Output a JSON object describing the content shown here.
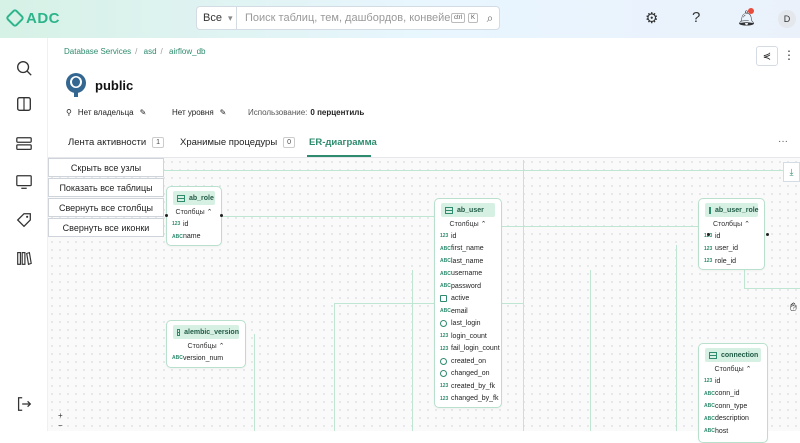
{
  "header": {
    "logo_text": "ADC",
    "search": {
      "scope": "Все",
      "placeholder": "Поиск таблиц, тем, дашбордов, конвейеров, м...",
      "shortcut_ctrl": "ctrl",
      "shortcut_key": "K"
    },
    "user_initial": "D"
  },
  "breadcrumb": [
    "Database Services",
    "asd",
    "airflow_db"
  ],
  "page": {
    "title": "public",
    "owner": "Нет владельца",
    "tier": "Нет уровня",
    "usage_label": "Использование:",
    "usage_value": "0 перцентиль"
  },
  "tabs": [
    {
      "label": "Лента активности",
      "count": "1"
    },
    {
      "label": "Хранимые процедуры",
      "count": "0"
    },
    {
      "label": "ER-диаграмма",
      "count": ""
    }
  ],
  "controls": {
    "hide_nodes": "Скрыть все узлы",
    "show_tables": "Показать все таблицы",
    "collapse_columns": "Свернуть все столбцы",
    "collapse_icons": "Свернуть все иконки",
    "zoom_in": "+",
    "zoom_out": "−"
  },
  "columns_label": "Столбцы",
  "nodes": {
    "ab_role": {
      "name": "ab_role",
      "columns": [
        {
          "type": "123",
          "name": "id"
        },
        {
          "type": "ABC",
          "name": "name"
        }
      ]
    },
    "ab_user": {
      "name": "ab_user",
      "columns": [
        {
          "type": "123",
          "name": "id"
        },
        {
          "type": "ABC",
          "name": "first_name"
        },
        {
          "type": "ABC",
          "name": "last_name"
        },
        {
          "type": "ABC",
          "name": "username"
        },
        {
          "type": "ABC",
          "name": "password"
        },
        {
          "type": "bool",
          "name": "active"
        },
        {
          "type": "ABC",
          "name": "email"
        },
        {
          "type": "time",
          "name": "last_login"
        },
        {
          "type": "123",
          "name": "login_count"
        },
        {
          "type": "123",
          "name": "fail_login_count"
        },
        {
          "type": "time",
          "name": "created_on"
        },
        {
          "type": "time",
          "name": "changed_on"
        },
        {
          "type": "123",
          "name": "created_by_fk"
        },
        {
          "type": "123",
          "name": "changed_by_fk"
        }
      ]
    },
    "ab_user_role": {
      "name": "ab_user_role",
      "columns": [
        {
          "type": "123",
          "name": "id"
        },
        {
          "type": "123",
          "name": "user_id"
        },
        {
          "type": "123",
          "name": "role_id"
        }
      ]
    },
    "alembic_version": {
      "name": "alembic_version",
      "columns": [
        {
          "type": "ABC",
          "name": "version_num"
        }
      ]
    },
    "connection": {
      "name": "connection",
      "columns": [
        {
          "type": "123",
          "name": "id"
        },
        {
          "type": "ABC",
          "name": "conn_id"
        },
        {
          "type": "ABC",
          "name": "conn_type"
        },
        {
          "type": "ABC",
          "name": "description"
        },
        {
          "type": "ABC",
          "name": "host"
        }
      ]
    }
  },
  "colors": {
    "accent": "#2e8b6e",
    "node_head": "#d7f0e4",
    "edge": "#bfe6d2"
  }
}
